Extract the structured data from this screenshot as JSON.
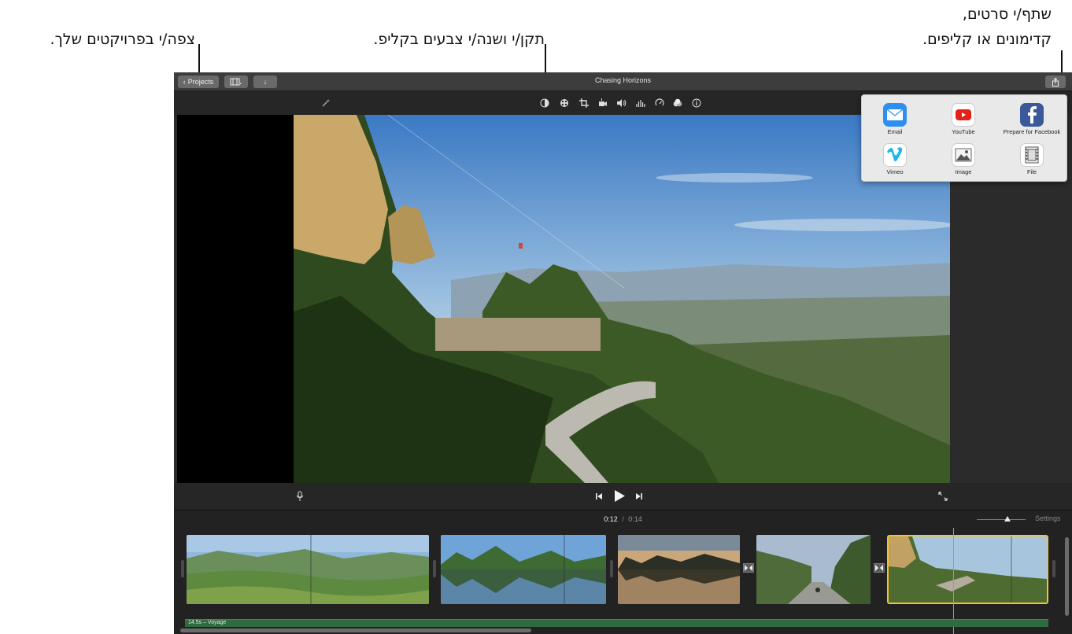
{
  "callouts": {
    "share_line1": "שתף/י סרטים,",
    "share_line2": "קדימונים או קליפים.",
    "adjust": "תקן/י ושנה/י צבעים בקליפ.",
    "projects": "צפה/י בפרויקטים שלך."
  },
  "titlebar": {
    "projects_button": "Projects",
    "title": "Chasing Horizons"
  },
  "toolbar": {
    "icons": [
      "magic-wand-icon",
      "color-balance-icon",
      "color-correction-icon",
      "crop-icon",
      "stabilization-icon",
      "volume-icon",
      "noise-reduction-icon",
      "speed-icon",
      "clip-filter-icon",
      "info-icon"
    ]
  },
  "playback": {
    "current_time": "0:12",
    "separator": "/",
    "total_time": "0:14"
  },
  "timeline": {
    "settings_label": "Settings",
    "audio_track_label": "14.5s – Voyage"
  },
  "share_menu": {
    "items": [
      {
        "label": "Email",
        "icon": "email-icon"
      },
      {
        "label": "YouTube",
        "icon": "youtube-icon"
      },
      {
        "label": "Prepare for Facebook",
        "icon": "facebook-icon"
      },
      {
        "label": "Vimeo",
        "icon": "vimeo-icon"
      },
      {
        "label": "Image",
        "icon": "image-icon"
      },
      {
        "label": "File",
        "icon": "file-icon"
      }
    ]
  },
  "colors": {
    "selected_clip_border": "#f2c230",
    "audio_track": "#2f6b3f",
    "email_blue": "#2e8ff0",
    "youtube_red": "#e62117",
    "facebook_blue": "#3b5998",
    "vimeo_cyan": "#1ab7ea"
  }
}
